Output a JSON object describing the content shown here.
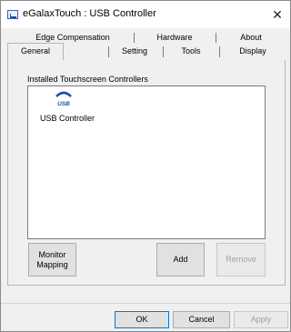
{
  "window": {
    "title": "eGalaxTouch : USB Controller",
    "close_symbol": "✕"
  },
  "tabs": {
    "row_back": [
      "Edge Compensation",
      "Hardware",
      "About"
    ],
    "row_front": [
      "General",
      "Setting",
      "Tools",
      "Display"
    ],
    "active": "General"
  },
  "general": {
    "group_label": "Installed Touchscreen Controllers",
    "controllers": [
      {
        "icon": "usb-icon",
        "icon_text": "USB",
        "label": "USB Controller"
      }
    ]
  },
  "buttons": {
    "monitor_mapping": "Monitor\nMapping",
    "add": "Add",
    "remove": "Remove",
    "ok": "OK",
    "cancel": "Cancel",
    "apply": "Apply"
  },
  "colors": {
    "usb_icon_blue": "#1f4fa0",
    "focus_border": "#0078d7",
    "disabled_text": "#a0a0a0"
  }
}
